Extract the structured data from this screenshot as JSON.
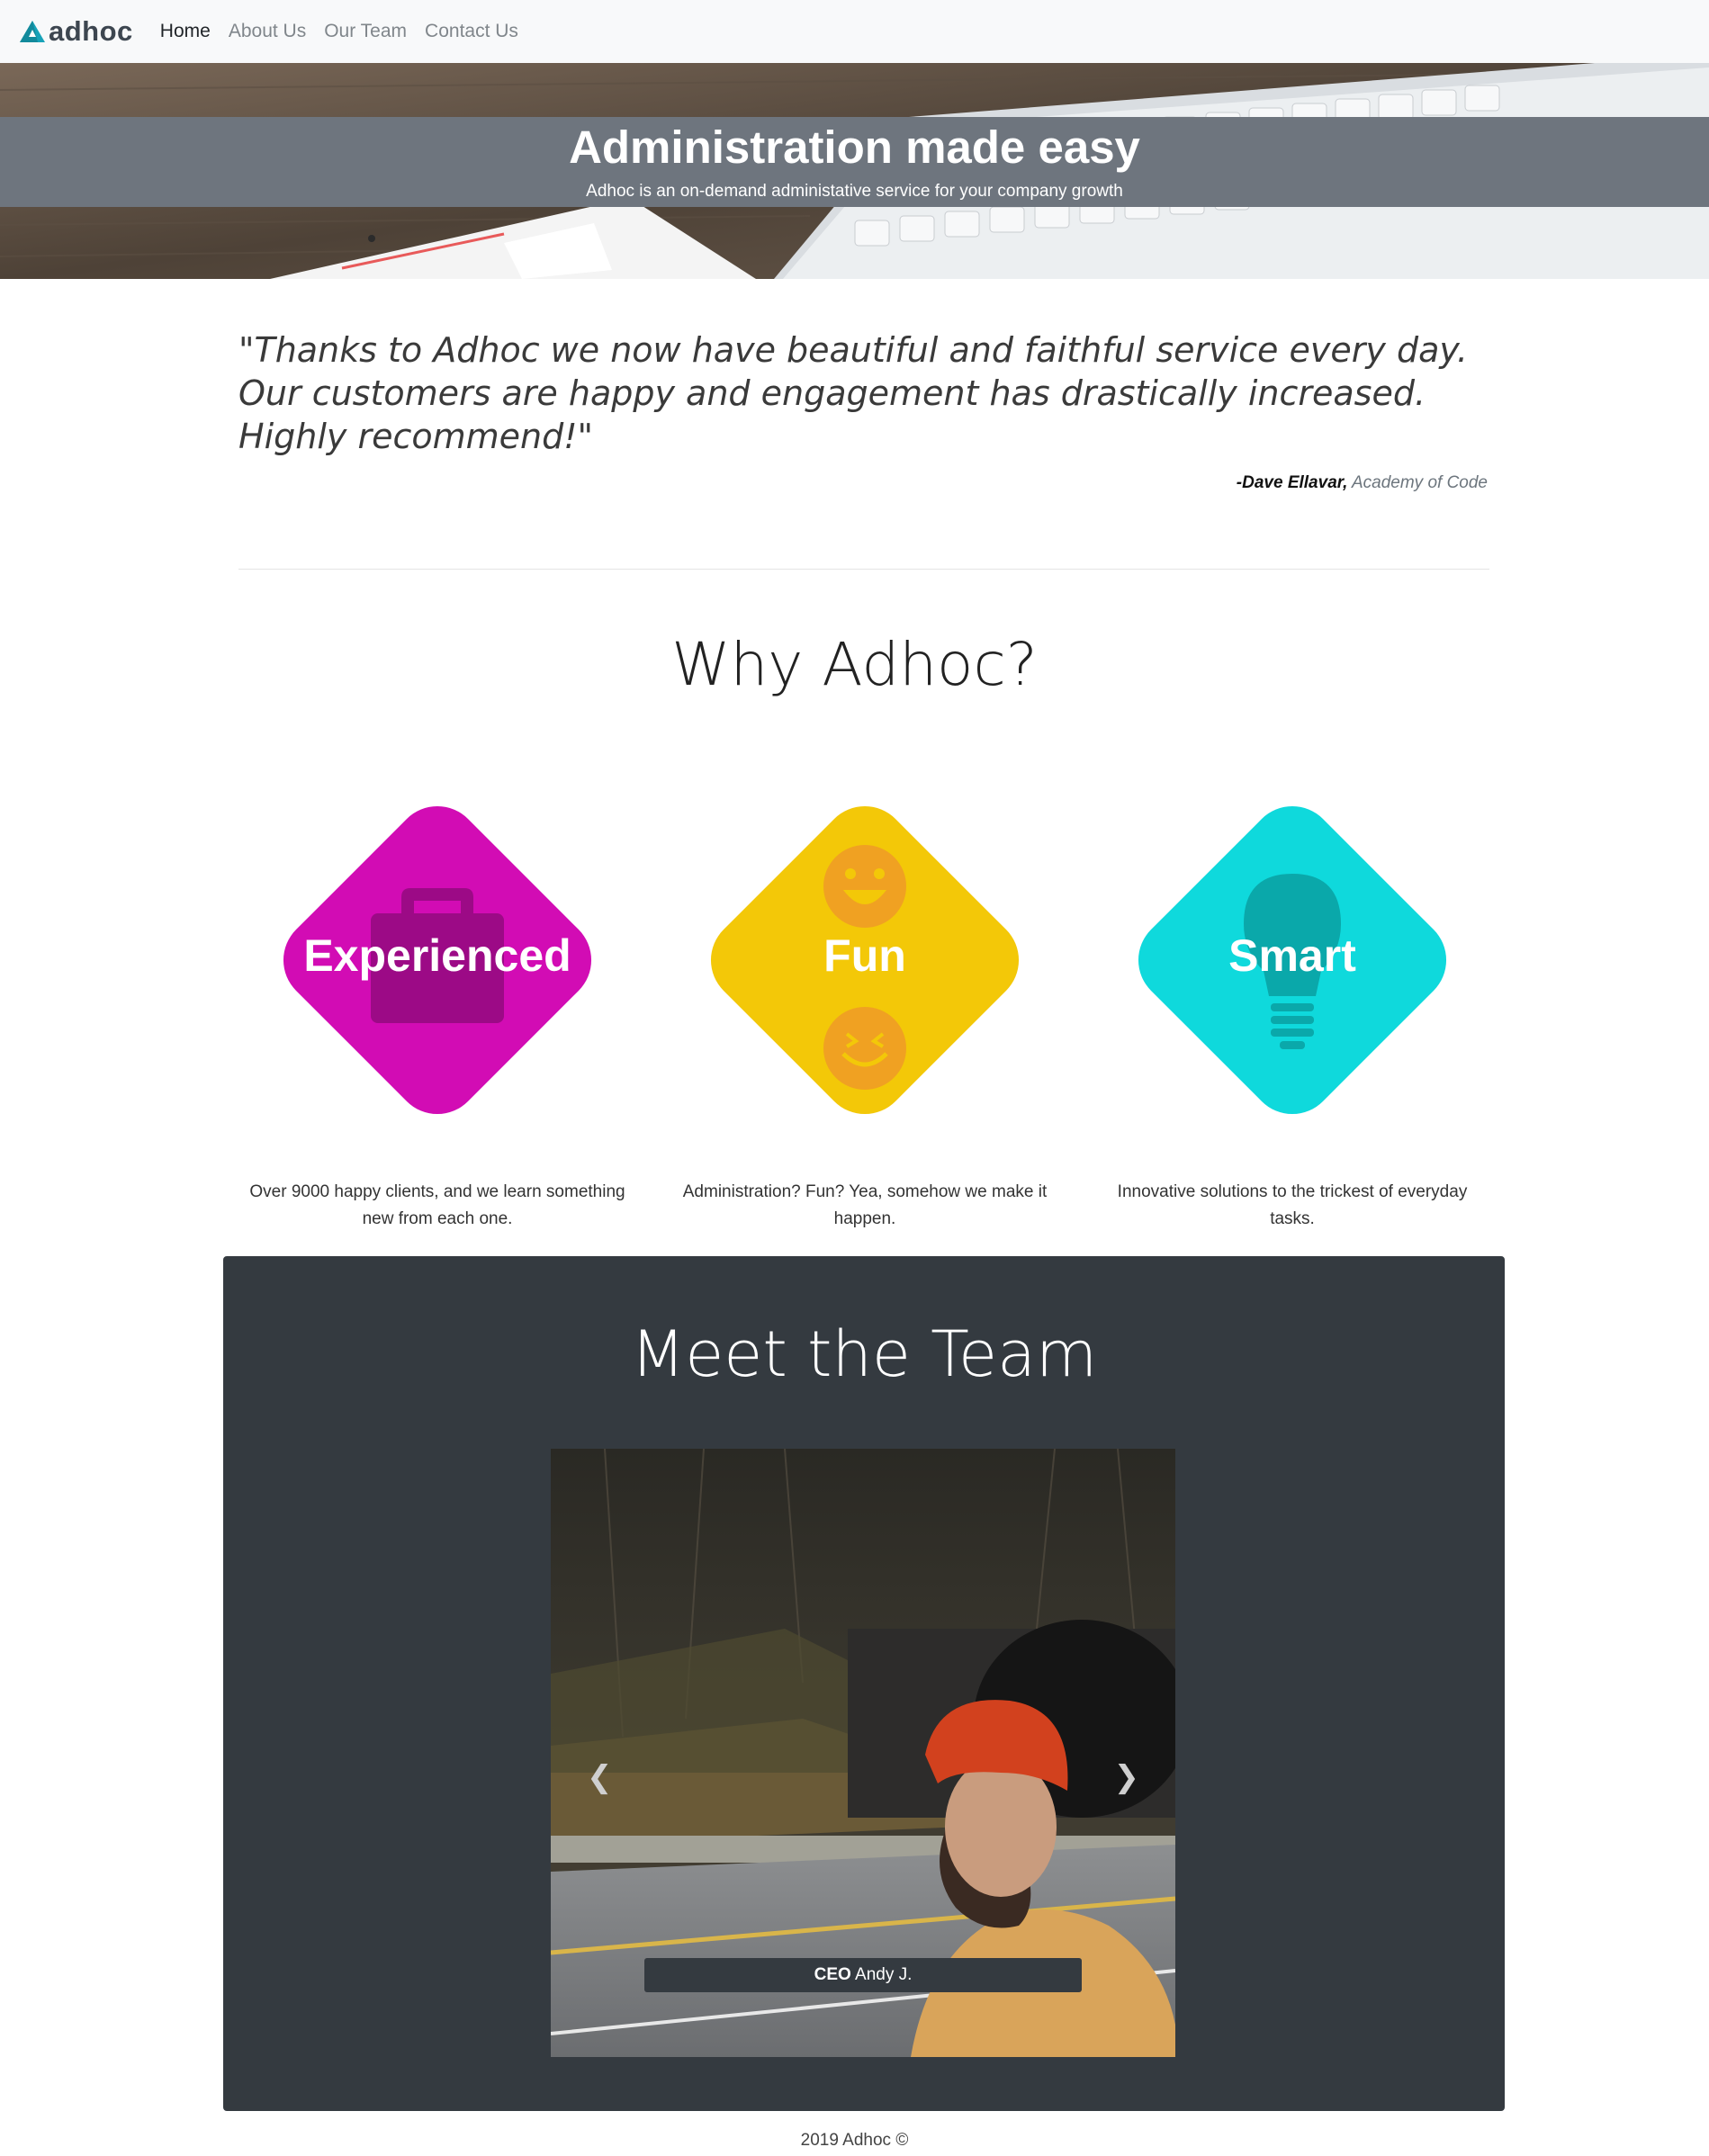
{
  "brand": {
    "name": "adhoc",
    "accent": "#17a2b8"
  },
  "nav": {
    "items": [
      {
        "label": "Home",
        "active": true
      },
      {
        "label": "About Us",
        "active": false
      },
      {
        "label": "Our Team",
        "active": false
      },
      {
        "label": "Contact Us",
        "active": false
      }
    ]
  },
  "hero": {
    "title": "Administration made easy",
    "subtitle": "Adhoc is an on-demand administative service for your company growth"
  },
  "testimonial": {
    "quote": "\"Thanks to Adhoc we now have beautiful and faithful service every day. Our customers are happy and engagement has drastically increased. Highly recommend!\"",
    "author": "-Dave Ellavar,",
    "company": "Academy of Code"
  },
  "why": {
    "title": "Why Adhoc?",
    "features": [
      {
        "label": "Experienced",
        "icon": "briefcase-icon",
        "color": "#d20cb4",
        "description": "Over 9000 happy clients, and we learn something new from each one."
      },
      {
        "label": "Fun",
        "icon": "smiley-icon",
        "color": "#f3c808",
        "description": "Administration? Fun? Yea, somehow we make it happen."
      },
      {
        "label": "Smart",
        "icon": "lightbulb-icon",
        "color": "#0fd9dc",
        "description": "Innovative solutions to the trickest of everyday tasks."
      }
    ]
  },
  "team": {
    "title": "Meet the Team",
    "slide": {
      "role": "CEO",
      "name": "Andy J."
    }
  },
  "footer": {
    "text": "2019 Adhoc ©"
  }
}
